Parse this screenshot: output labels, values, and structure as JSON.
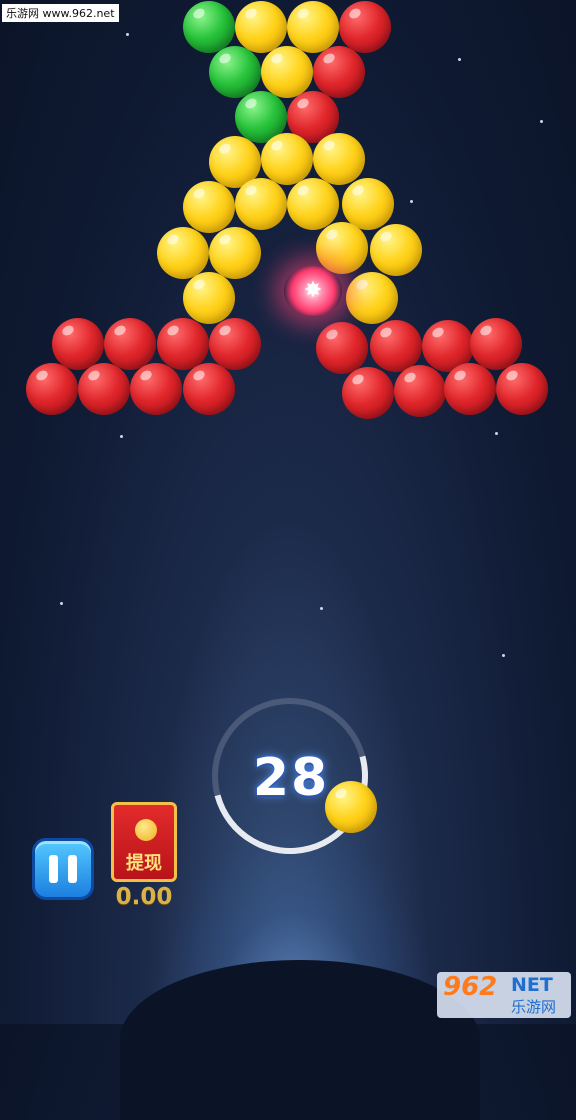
{
  "watermark_top": "乐游网 www.962.net",
  "moves_remaining": "28",
  "redpacket_label": "提现",
  "balance": "0.00",
  "logo": {
    "number": "962",
    "net": "NET",
    "cn": "乐游网"
  },
  "special_bubble_symbol": "✸",
  "icons": {
    "pause": "pause-icon",
    "coin": "coin-icon"
  }
}
